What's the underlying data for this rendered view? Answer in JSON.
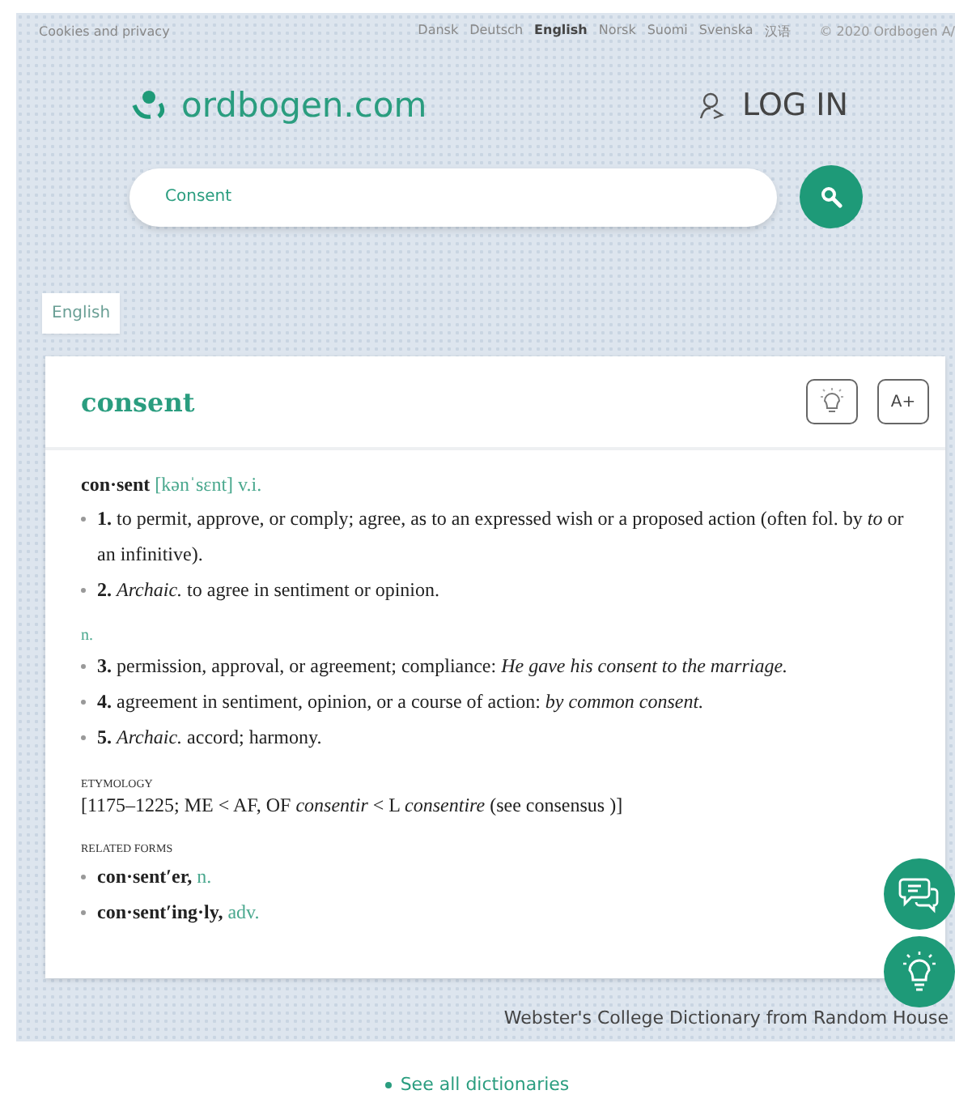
{
  "topbar": {
    "privacy_link": "Cookies and privacy",
    "languages": [
      {
        "label": "Dansk",
        "selected": false
      },
      {
        "label": "Deutsch",
        "selected": false
      },
      {
        "label": "English",
        "selected": true
      },
      {
        "label": "Norsk",
        "selected": false
      },
      {
        "label": "Suomi",
        "selected": false
      },
      {
        "label": "Svenska",
        "selected": false
      },
      {
        "label": "汉语",
        "selected": false
      }
    ],
    "copyright": "© 2020 Ordbogen A/"
  },
  "header": {
    "logo": "ordbogen.com",
    "login": "LOG IN"
  },
  "search": {
    "value": "Consent"
  },
  "dictionary_tabs": [
    {
      "label": "English",
      "selected": true
    }
  ],
  "entry": {
    "title": "consent",
    "toolbar": [
      "A+"
    ],
    "headword": "con·sent",
    "pronunciation": "[kənˈsɛnt]",
    "part_of_speech": "v.i.",
    "senses": [
      "**1.** to permit, approve, or comply; agree, as to an expressed wish or a proposed action (often fol. by *to* or an infinitive).",
      "**2.** *Archaic.* to agree in sentiment or opinion."
    ],
    "noun_label": "n.",
    "noun_senses": [
      "**3.** permission, approval, or agreement; compliance: *He gave his consent to the marriage.*",
      "**4.** agreement in sentiment, opinion, or a course of action: *by common consent.*",
      "**5.** *Archaic.* accord; harmony."
    ],
    "etymology_heading": "ETYMOLOGY",
    "etymology": "[1175–1225; ME < AF, OF *consentir* < L *consentire* (see consensus )]",
    "related_heading": "RELATED FORMS",
    "related_forms": [
      {
        "form": "con·sent′er,",
        "pos": "n."
      },
      {
        "form": "con·sent′ing·ly,",
        "pos": "adv."
      }
    ]
  },
  "source": "Webster's College Dictionary from Random House",
  "see_all": "See all dictionaries"
}
